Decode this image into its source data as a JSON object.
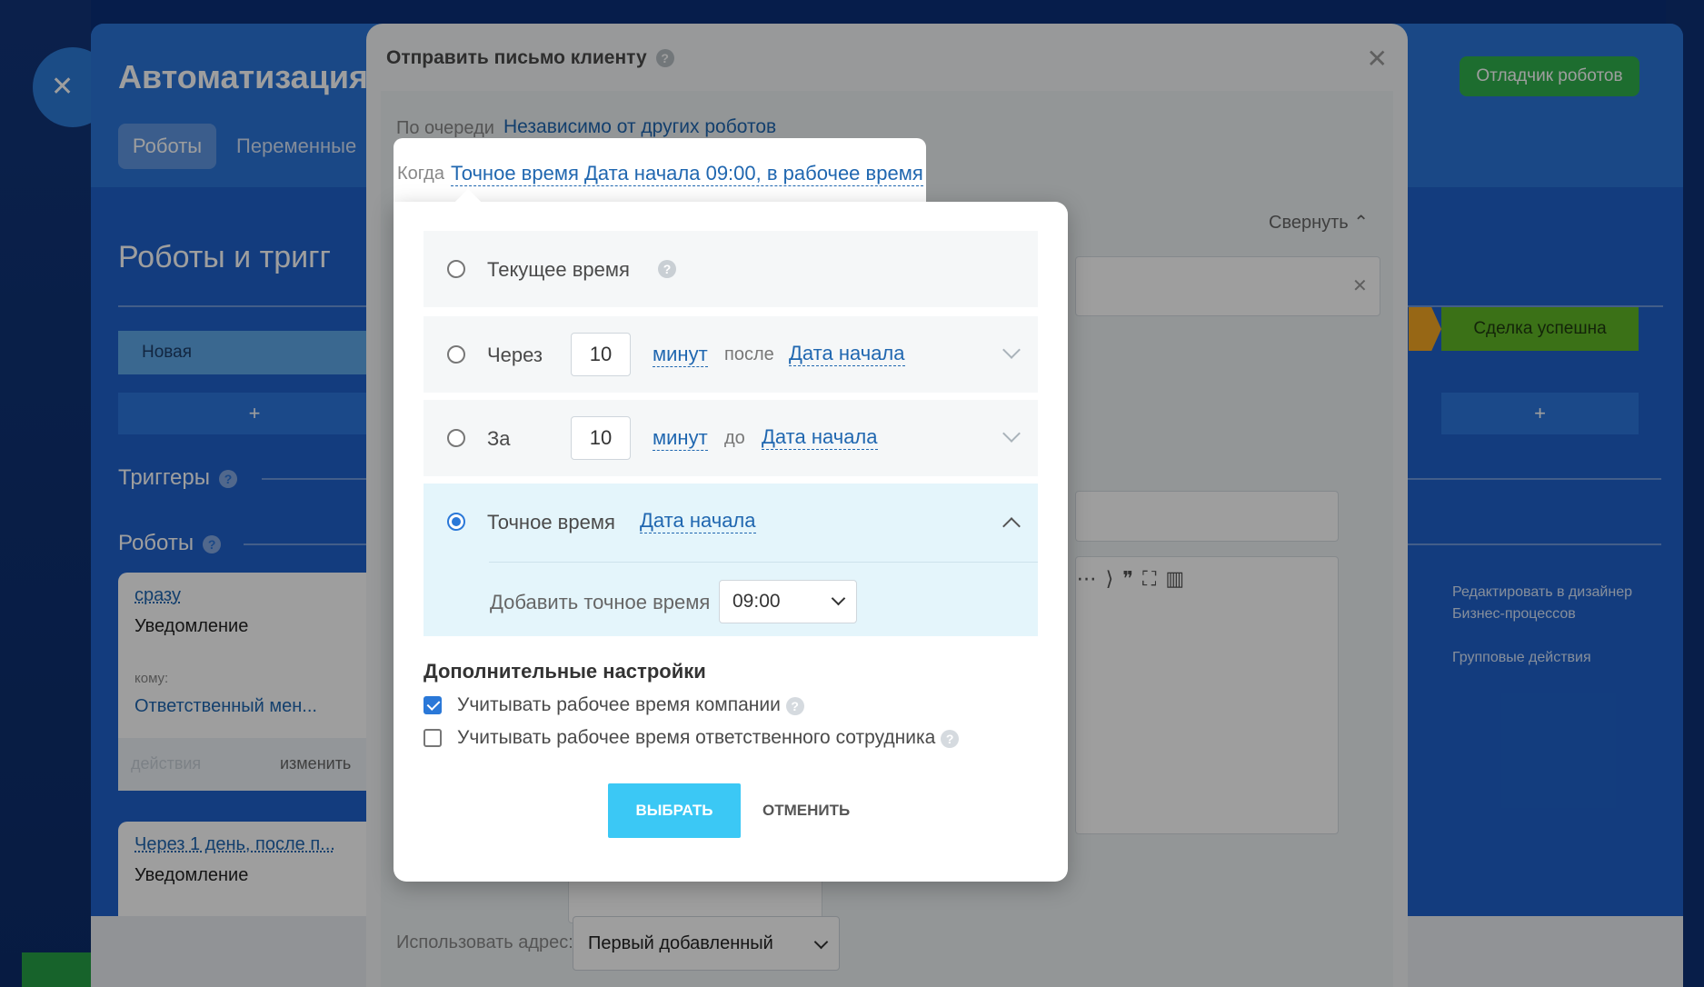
{
  "background": {
    "app_title": "Автоматизация",
    "tabs": [
      "Роботы",
      "Переменные"
    ],
    "page_heading": "Роботы и тригг",
    "stage_new": "Новая",
    "stage_success": "Сделка успешна",
    "plus": "+",
    "triggers_label": "Триггеры",
    "robots_label": "Роботы",
    "debug_button": "Отладчик роботов",
    "right_menu": [
      "Редактировать в дизайнер",
      "Бизнес-процессов",
      "Групповые действия"
    ],
    "card1": {
      "when": "сразу",
      "type": "Уведомление",
      "label": "кому:",
      "value": "Ответственный мен...",
      "actions": "действия",
      "edit": "изменить"
    },
    "card2": {
      "when": "Через 1 день, после п...",
      "type": "Уведомление"
    }
  },
  "dialog": {
    "title": "Отправить письмо клиенту",
    "queue_label": "По очереди",
    "queue_value": "Независимо от других роботов",
    "collapse": "Свернуть",
    "address_label": "Использовать адрес:",
    "address_value": "Первый добавленный"
  },
  "when": {
    "label": "Когда",
    "value": "Точное время Дата начала 09:00, в рабочее время"
  },
  "popup": {
    "opt_current": "Текущее время",
    "opt_after": {
      "label": "Через",
      "number": "10",
      "unit": "минут",
      "relation": "после",
      "field": "Дата начала"
    },
    "opt_before": {
      "label": "За",
      "number": "10",
      "unit": "минут",
      "relation": "до",
      "field": "Дата начала"
    },
    "opt_exact": {
      "label": "Точное время",
      "field": "Дата начала",
      "add_label": "Добавить точное время",
      "time": "09:00"
    },
    "advanced_title": "Дополнительные настройки",
    "cb_company": "Учитывать рабочее время компании",
    "cb_employee": "Учитывать рабочее время ответственного сотрудника",
    "select_button": "ВЫБРАТЬ",
    "cancel_button": "ОТМЕНИТЬ"
  }
}
